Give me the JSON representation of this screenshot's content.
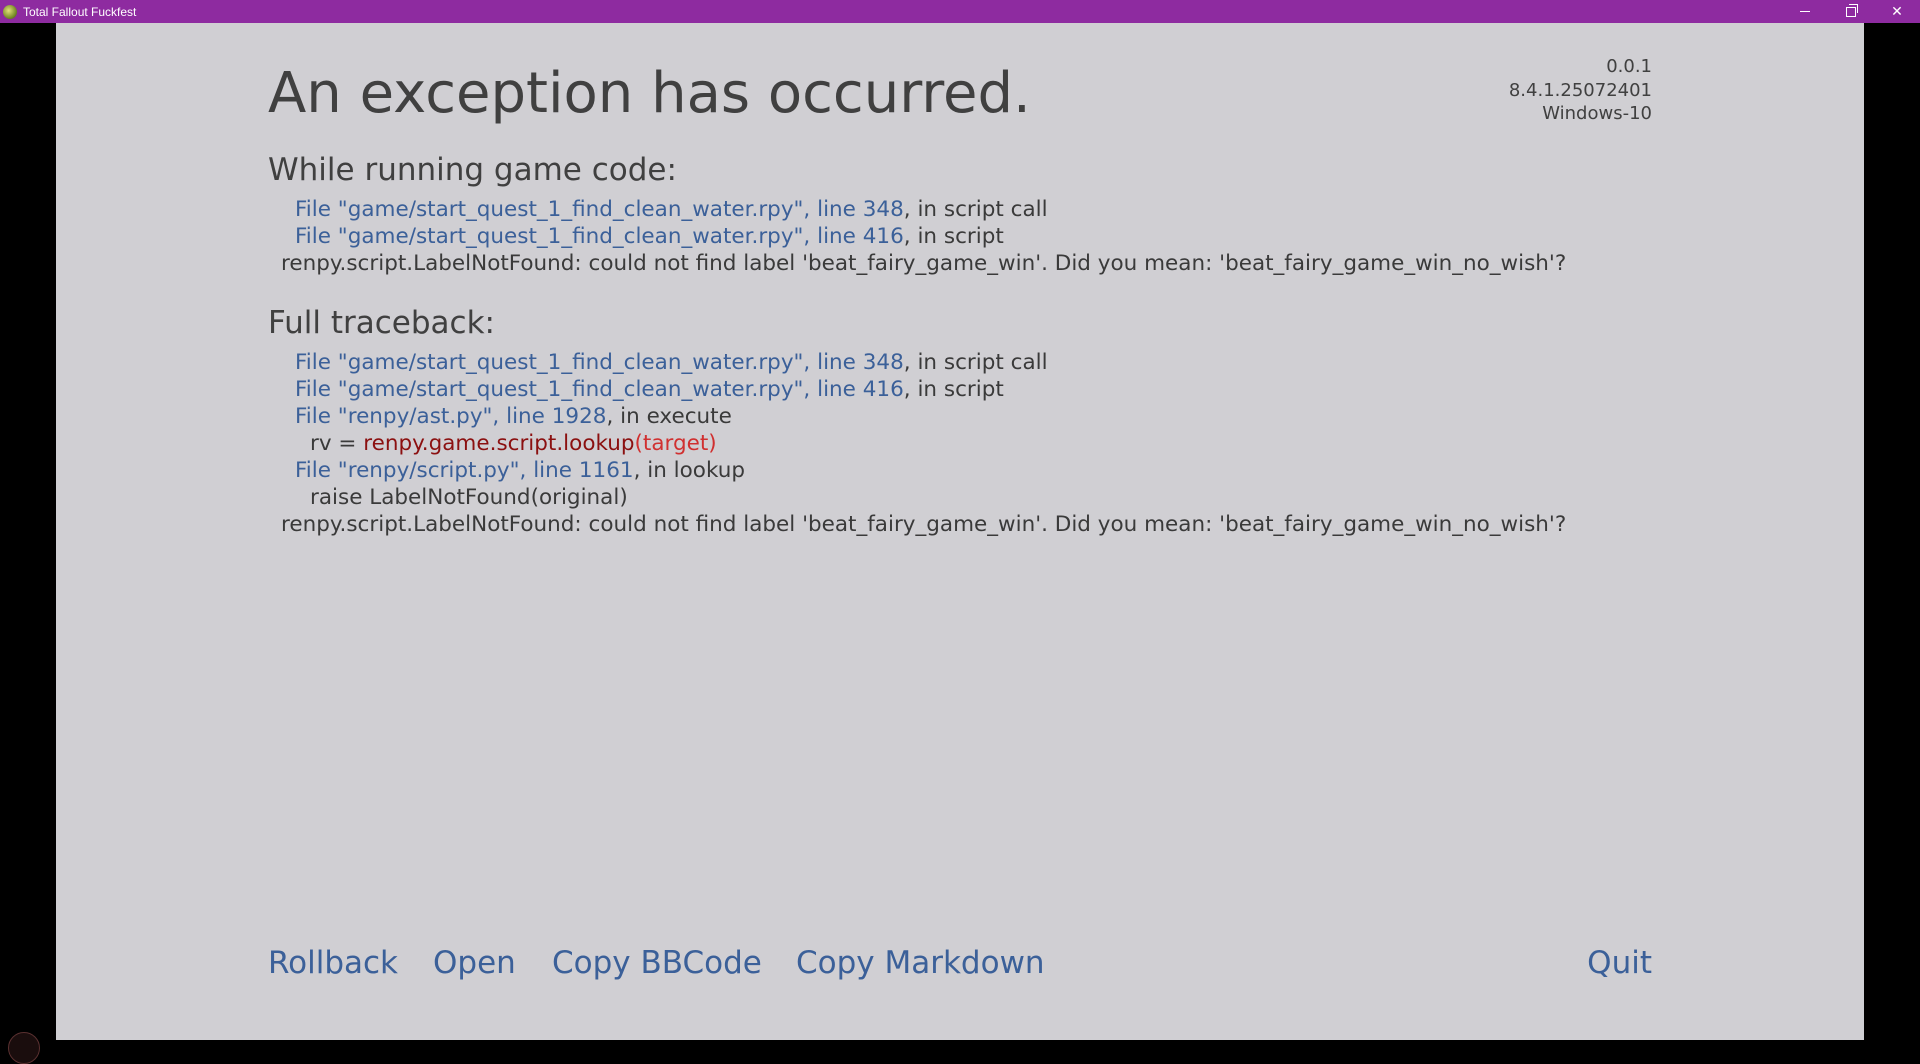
{
  "window": {
    "title": "Total Fallout Fuckfest",
    "minimize_icon": "minimize-icon",
    "restore_icon": "restore-icon",
    "close_icon": "close-icon",
    "titlebar_color": "#8e2ba0"
  },
  "error": {
    "heading": "An exception has occurred.",
    "version": [
      "0.0.1",
      "8.4.1.25072401",
      "Windows-10"
    ],
    "game_code": {
      "title": "While running game code:",
      "lines": [
        {
          "link": "File \"game/start_quest_1_find_clean_water.rpy\", line 348",
          "rest": ", in script call"
        },
        {
          "link": "File \"game/start_quest_1_find_clean_water.rpy\", line 416",
          "rest": ", in script"
        }
      ],
      "message": "renpy.script.LabelNotFound: could not find label 'beat_fairy_game_win'. Did you mean: 'beat_fairy_game_win_no_wish'?"
    },
    "full_traceback": {
      "title": "Full traceback:",
      "line1": {
        "link": "File \"game/start_quest_1_find_clean_water.rpy\", line 348",
        "rest": ", in script call"
      },
      "line2": {
        "link": "File \"game/start_quest_1_find_clean_water.rpy\", line 416",
        "rest": ", in script"
      },
      "line3": {
        "link": "File \"renpy/ast.py\", line 1928",
        "rest": ", in execute"
      },
      "code3": {
        "prefix": "rv = ",
        "call": "renpy.game.script.lookup",
        "args": "(target)"
      },
      "line4": {
        "link": "File \"renpy/script.py\", line 1161",
        "rest": ", in lookup"
      },
      "code4": "raise LabelNotFound(original)",
      "message": "renpy.script.LabelNotFound: could not find label 'beat_fairy_game_win'. Did you mean: 'beat_fairy_game_win_no_wish'?"
    }
  },
  "buttons": {
    "rollback": "Rollback",
    "open": "Open",
    "copy_bbcode": "Copy BBCode",
    "copy_markdown": "Copy Markdown",
    "quit": "Quit"
  },
  "colors": {
    "background": "#d0cfd3",
    "text": "#404040",
    "link": "#3b6099",
    "highlight": "#8b1010",
    "highlight_args": "#d03030"
  }
}
